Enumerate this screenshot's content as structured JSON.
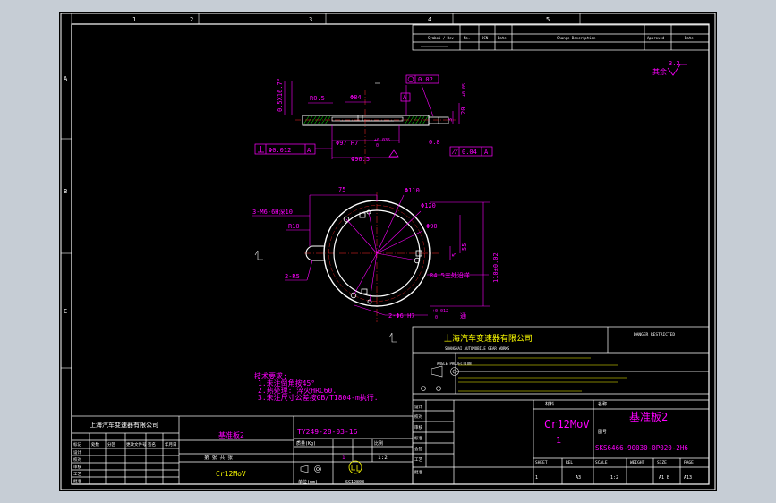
{
  "colors": {
    "background": "#c6cdd5",
    "paper": "#000000",
    "frame": "#ffffff",
    "dimension": "#ff00ff",
    "centerline": "#ff2a2a",
    "geometry": "#ffffff",
    "text_accent": "#ffff00",
    "hatch": "#00ff00"
  },
  "zone_numbers": [
    "1",
    "2",
    "3",
    "4",
    "5"
  ],
  "zone_letters": [
    "A",
    "B",
    "C"
  ],
  "revision_table": {
    "headers": [
      "Symbol / Rev",
      "No.",
      "DCN",
      "Date",
      "Change Description",
      "Approved",
      "Date"
    ]
  },
  "surface_note": {
    "symbol_value": "3.2",
    "text": "其余"
  },
  "front_view": {
    "dimensions": {
      "chamfer": "0.5X16.7°",
      "r05": "R0.5",
      "d84": "Φ84",
      "datum_a": "A",
      "circularity": "0.02",
      "d97": "Φ97 H7",
      "d97_tol_upper": "+0.035",
      "d97_tol_lower": "0",
      "d96": "Φ96.5",
      "height_3": "3",
      "height_20": "20",
      "height_20_tol": "+0.05",
      "flat_08": "0.8",
      "parallel_tol": "0.04",
      "parallel_datum": "A",
      "position_tol": "Φ0.012",
      "position_datum": "A"
    }
  },
  "plan_view": {
    "dimensions": {
      "d75": "75",
      "d110": "Φ110",
      "d120": "Φ120",
      "d90": "Φ90",
      "thread": "3-M6-6H深10",
      "r10": "R10",
      "r5": "2-R5",
      "width_5": "5",
      "depth_55": "55",
      "r45": "R4.5三处沿样",
      "height_110": "110±0.02",
      "pins": "2-Φ6 H7",
      "pins_tol_upper": "+0.012",
      "pins_tol_lower": "0",
      "pins_suffix": "通"
    }
  },
  "tech_notes": {
    "heading": "技术要求:",
    "lines": [
      "1.未注倒角按45°",
      "2.热处理: 淬火HRC60.",
      "3.未注尺寸公差按GB/T1804-m执行."
    ]
  },
  "title_block": {
    "company": "上海汽车变速器有限公司",
    "company_en": "SHANGHAI AUTOMOBILE GEAR WORKS",
    "banner": "DANGER RESTRICTED",
    "part_name_cn": "基准板2",
    "drawing_no": "TY249-28-03-16",
    "material": "Cr12MoV",
    "weight_label": "质量(Kg)",
    "scale_label": "比例",
    "quantity": "1",
    "scale": "1:2",
    "sheets": "第 张 共 张",
    "unit_label": "单位(mm)",
    "std": "SC1280B",
    "left_rows": [
      "标记",
      "处数",
      "分区",
      "更改文件号",
      "签名",
      "年月日"
    ],
    "left_roles": [
      "设计",
      "校对",
      "审核",
      "工艺",
      "标准化",
      "批准"
    ],
    "projection_label": "ANGLE PROJECTION",
    "roles": [
      "设计",
      "校对",
      "审核",
      "标准",
      "会签",
      "工艺",
      "批准"
    ],
    "material_hand": "Cr12MoV",
    "material_sub": "1",
    "name_hand": "基准板2",
    "drawing_hand": "SKS6466-90030-0P020-2H6",
    "bottom_labels": [
      "SHEET",
      "REL",
      "SCALE",
      "WEIGHT",
      "SIZE",
      "PAGE"
    ],
    "bottom_values": [
      "1",
      "A3",
      "1:2",
      "A1 B",
      "A13"
    ],
    "right_cells": [
      "材料",
      "MATERIAL",
      "名称",
      "NAME",
      "图号",
      "DWG NO."
    ]
  }
}
